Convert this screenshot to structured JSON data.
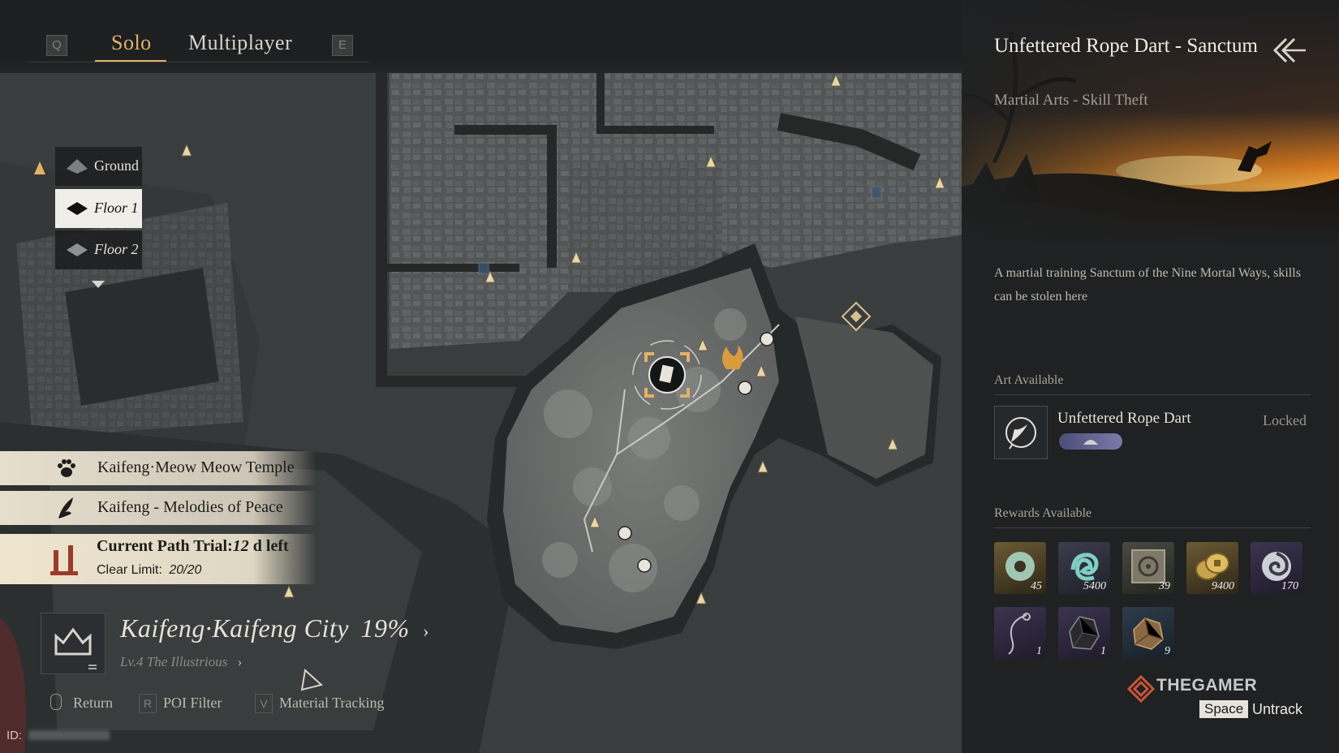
{
  "tabs": {
    "left_key": "Q",
    "right_key": "E",
    "items": [
      {
        "label": "Solo",
        "active": true
      },
      {
        "label": "Multiplayer",
        "active": false
      }
    ]
  },
  "floors": [
    {
      "label": "Ground",
      "selected": false
    },
    {
      "label": "Floor 1",
      "selected": true
    },
    {
      "label": "Floor 2",
      "selected": false
    }
  ],
  "banners": {
    "meow": "Kaifeng·Meow Meow Temple",
    "melodies": "Kaifeng - Melodies of Peace"
  },
  "trial": {
    "label": "Current Path Trial:",
    "time": "12",
    "time_unit": "d left",
    "clear_label": "Clear Limit:",
    "clear_value": "20/20"
  },
  "city": {
    "name": "Kaifeng·Kaifeng City",
    "percent": "19%",
    "level": "Lv.4 The Illustrious"
  },
  "controls": [
    {
      "key": "",
      "label": "Return"
    },
    {
      "key": "R",
      "label": "POI Filter"
    },
    {
      "key": "V",
      "label": "Material Tracking"
    }
  ],
  "id_label": "ID:",
  "panel": {
    "title": "Unfettered Rope Dart - Sanctum",
    "subtitle": "Martial Arts - Skill Theft",
    "description": "A martial training Sanctum of the Nine Mortal Ways, skills can be stolen here",
    "art_heading": "Art Available",
    "art_name": "Unfettered Rope Dart",
    "art_status": "Locked",
    "rewards_heading": "Rewards Available",
    "rewards": [
      {
        "name": "jade-ring",
        "count": "45"
      },
      {
        "name": "swirl-token",
        "count": "5400"
      },
      {
        "name": "bronze-plate",
        "count": "39"
      },
      {
        "name": "gold-coins",
        "count": "9400"
      },
      {
        "name": "spiral-orb",
        "count": "170"
      },
      {
        "name": "silver-chain",
        "count": "1"
      },
      {
        "name": "dark-ore",
        "count": "1"
      },
      {
        "name": "copper-ore",
        "count": "9"
      }
    ]
  },
  "footer": {
    "logo": "THEGAMER",
    "space_key": "Space",
    "untrack": "Untrack"
  },
  "colors": {
    "accent_gold": "#e2b267",
    "panel_bg": "#1f2122",
    "map_bg": "#2f3232",
    "locked_badge": "#6a6a9a"
  }
}
